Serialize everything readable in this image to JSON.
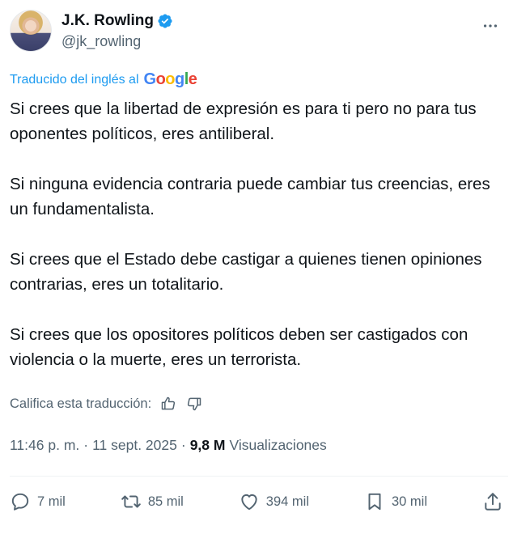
{
  "author": {
    "display_name": "J.K. Rowling",
    "handle": "@jk_rowling",
    "verified": true
  },
  "translation": {
    "label": "Traducido del inglés al",
    "provider": "Google"
  },
  "tweet": {
    "paragraphs": [
      "Si crees que la libertad de expresión es para ti pero no para tus oponentes políticos, eres antiliberal.",
      "Si ninguna evidencia contraria puede cambiar tus creencias, eres un fundamentalista.",
      "Si crees que el Estado debe castigar a quienes tienen opiniones contrarias, eres un totalitario.",
      "Si crees que los opositores políticos deben ser castigados con violencia o la muerte, eres un terrorista."
    ]
  },
  "rate_translation": {
    "label": "Califica esta traducción:"
  },
  "meta": {
    "time": "11:46 p. m.",
    "separator": "·",
    "date": "11 sept. 2025",
    "views_count": "9,8 M",
    "views_label": "Visualizaciones"
  },
  "actions": {
    "replies": "7 mil",
    "reposts": "85 mil",
    "likes": "394 mil",
    "bookmarks": "30 mil"
  },
  "colors": {
    "accent": "#1d9bf0",
    "secondary_text": "#536471",
    "primary_text": "#0f1419"
  },
  "icons": [
    "verified-badge-icon",
    "more-icon",
    "thumbs-up-icon",
    "thumbs-down-icon",
    "reply-icon",
    "repost-icon",
    "like-icon",
    "bookmark-icon",
    "share-icon"
  ]
}
